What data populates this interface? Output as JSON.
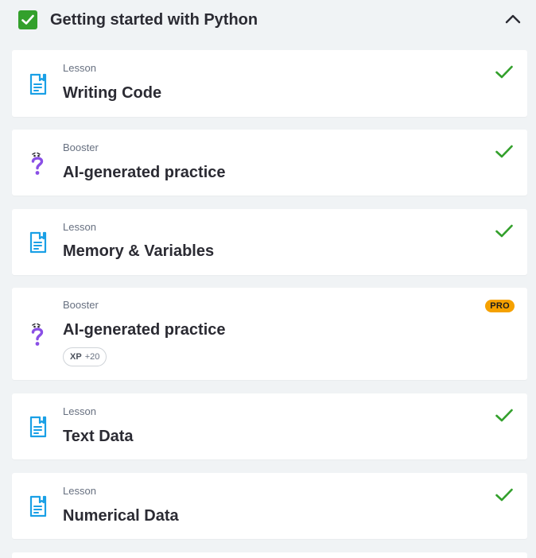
{
  "section": {
    "title": "Getting started with Python",
    "completed": true,
    "expanded": true
  },
  "colors": {
    "accent_green": "#33a02c",
    "lesson_icon_blue": "#1aa0e6",
    "booster_purple": "#8a4fe6",
    "pro_orange": "#f5a100"
  },
  "items": [
    {
      "kind": "Lesson",
      "title": "Writing Code",
      "icon": "lesson-document-icon",
      "status": "completed"
    },
    {
      "kind": "Booster",
      "title": "AI-generated practice",
      "icon": "question-mark-icon",
      "status": "completed"
    },
    {
      "kind": "Lesson",
      "title": "Memory & Variables",
      "icon": "lesson-document-icon",
      "status": "completed"
    },
    {
      "kind": "Booster",
      "title": "AI-generated practice",
      "icon": "question-mark-icon",
      "status": "locked-pro",
      "badge": "PRO",
      "xp_label": "XP",
      "xp_value": "+20"
    },
    {
      "kind": "Lesson",
      "title": "Text Data",
      "icon": "lesson-document-icon",
      "status": "completed"
    },
    {
      "kind": "Lesson",
      "title": "Numerical Data",
      "icon": "lesson-document-icon",
      "status": "completed"
    }
  ]
}
